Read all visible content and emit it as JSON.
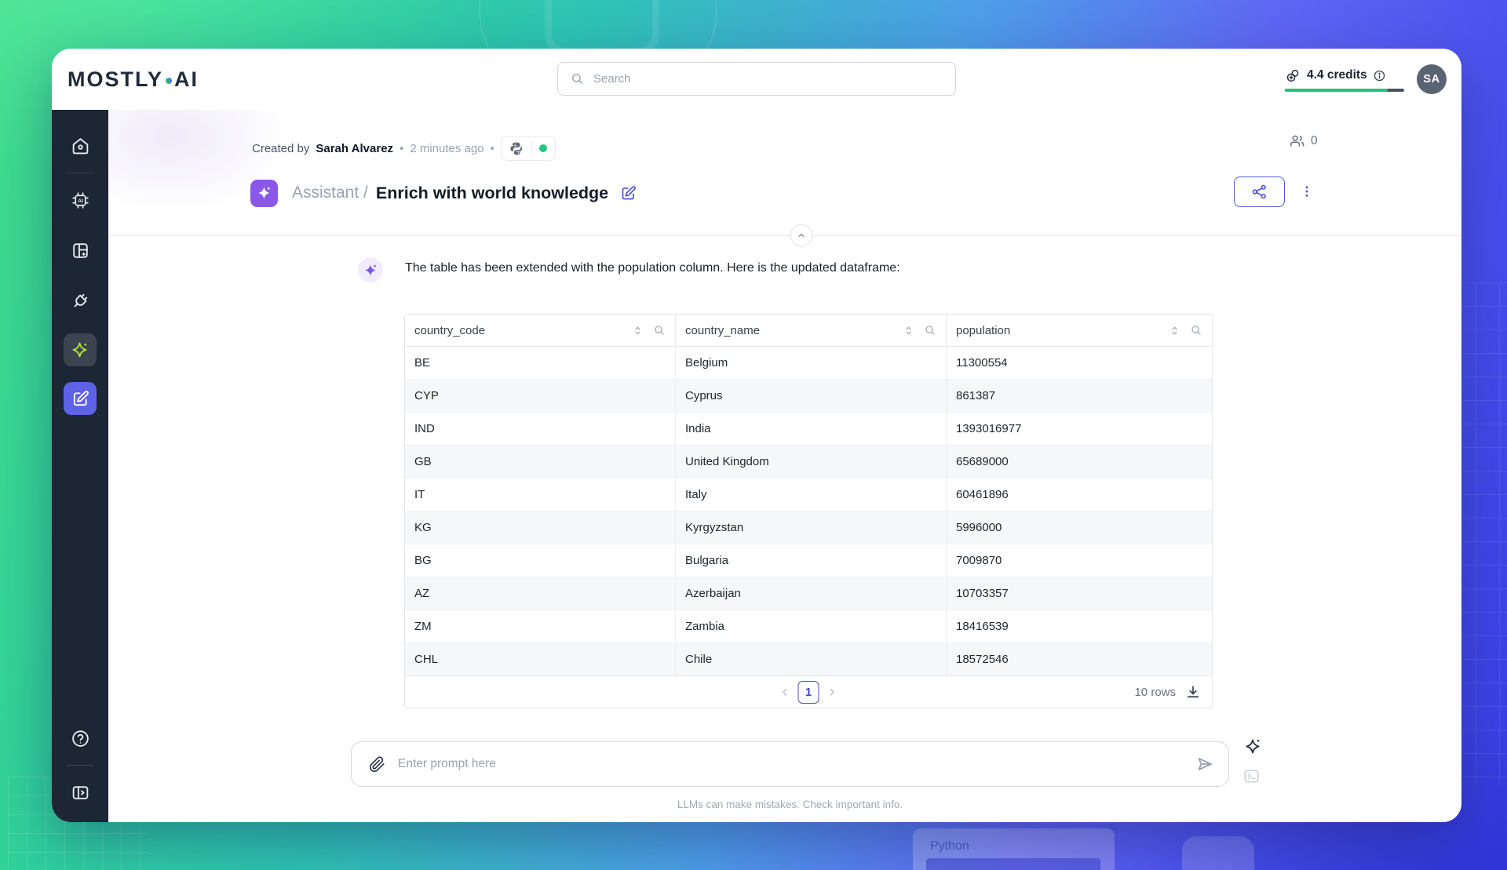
{
  "topbar": {
    "logo_main": "MOSTLY",
    "logo_suffix": "AI",
    "search_placeholder": "Search",
    "credits_label": "4.4 credits",
    "credits_fill_pct": 86,
    "avatar_initials": "SA"
  },
  "header": {
    "created_by_prefix": "Created by",
    "author": "Sarah Alvarez",
    "separator": "•",
    "time_ago": "2 minutes ago",
    "collaborator_count": "0",
    "breadcrumb": "Assistant /",
    "title": "Enrich with world knowledge"
  },
  "chat": {
    "assistant_message": "The table has been extended with the population column. Here is the updated dataframe:"
  },
  "table": {
    "columns": [
      "country_code",
      "country_name",
      "population"
    ],
    "rows": [
      [
        "BE",
        "Belgium",
        "11300554"
      ],
      [
        "CYP",
        "Cyprus",
        "861387"
      ],
      [
        "IND",
        "India",
        "1393016977"
      ],
      [
        "GB",
        "United Kingdom",
        "65689000"
      ],
      [
        "IT",
        "Italy",
        "60461896"
      ],
      [
        "KG",
        "Kyrgyzstan",
        "5996000"
      ],
      [
        "BG",
        "Bulgaria",
        "7009870"
      ],
      [
        "AZ",
        "Azerbaijan",
        "10703357"
      ],
      [
        "ZM",
        "Zambia",
        "18416539"
      ],
      [
        "CHL",
        "Chile",
        "18572546"
      ]
    ],
    "pagination": {
      "current_page": "1",
      "rows_label": "10 rows"
    }
  },
  "prompt": {
    "placeholder": "Enter prompt here",
    "disclaimer": "LLMs can make mistakes. Check important info."
  },
  "background": {
    "python_label": "Python"
  },
  "colors": {
    "accent_indigo": "#4c52d9",
    "accent_purple": "#8a57e8",
    "accent_green": "#1fc77c",
    "accent_lime": "#b4e43c",
    "sidebar_bg": "#1c2634"
  }
}
